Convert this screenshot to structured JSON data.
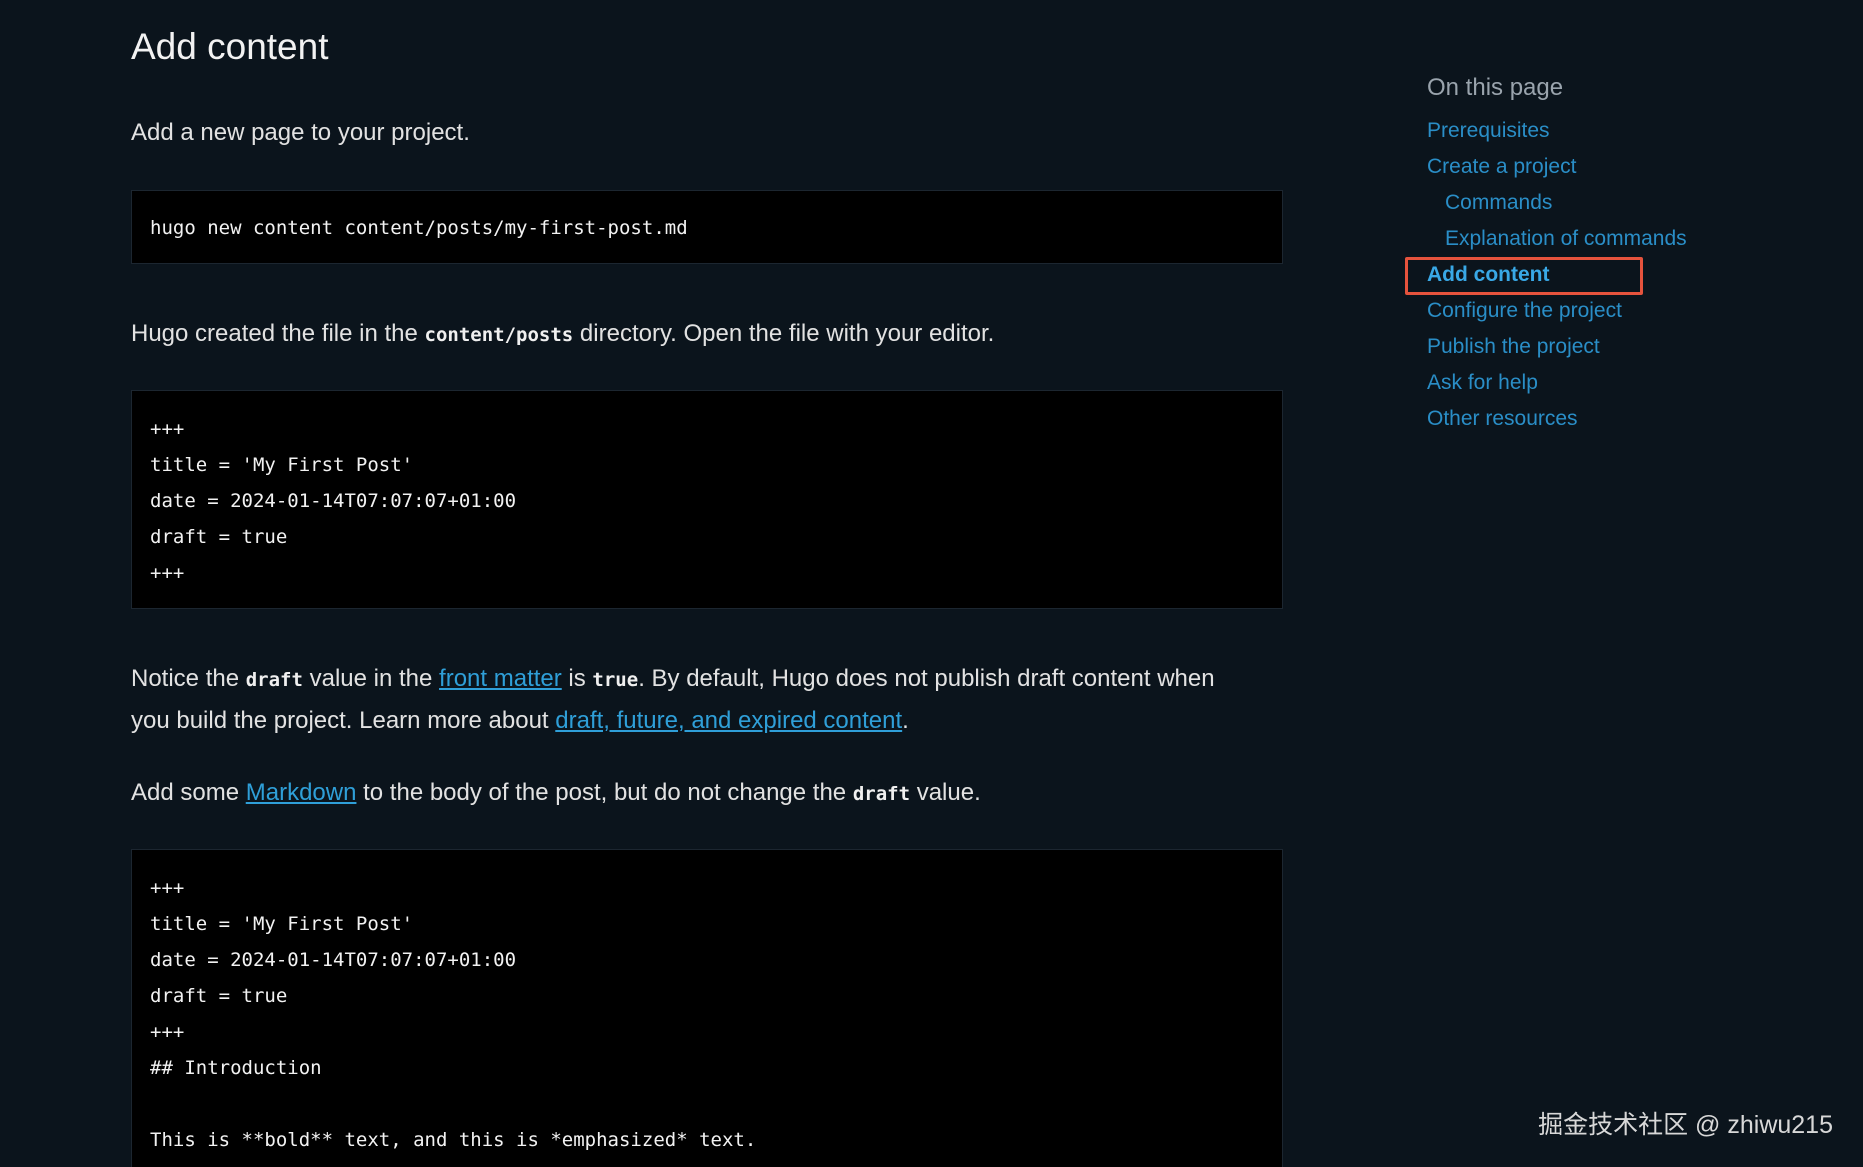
{
  "main": {
    "title": "Add content",
    "intro": "Add a new page to your project.",
    "command": "hugo new content content/posts/my-first-post.md",
    "created_text_1": "Hugo created the file in the ",
    "created_code": "content/posts",
    "created_text_2": " directory. Open the file with your editor.",
    "front_matter_lines": [
      "+++",
      "title = 'My First Post'",
      "date = 2024-01-14T07:07:07+01:00",
      "draft = true",
      "+++"
    ],
    "notice": {
      "t1": "Notice the ",
      "code1": "draft",
      "t2": " value in the ",
      "link1": "front matter",
      "t3": " is ",
      "code2": "true",
      "t4": ". By default, Hugo does not publish draft content when",
      "t5": "you build the project. Learn more about ",
      "link2": "draft, future, and expired content",
      "t6": "."
    },
    "markdown_para": {
      "t1": "Add some ",
      "link": "Markdown",
      "t2": " to the body of the post, but do not change the ",
      "code": "draft",
      "t3": " value."
    },
    "body_lines": [
      "+++",
      "title = 'My First Post'",
      "date = 2024-01-14T07:07:07+01:00",
      "draft = true",
      "+++",
      "## Introduction",
      "",
      "This is **bold** text, and this is *emphasized* text."
    ]
  },
  "toc": {
    "title": "On this page",
    "items": [
      {
        "label": "Prerequisites"
      },
      {
        "label": "Create a project"
      },
      {
        "label": "Commands"
      },
      {
        "label": "Explanation of commands"
      },
      {
        "label": "Add content"
      },
      {
        "label": "Configure the project"
      },
      {
        "label": "Publish the project"
      },
      {
        "label": "Ask for help"
      },
      {
        "label": "Other resources"
      }
    ]
  },
  "watermark": "掘金技术社区 @ zhiwu215",
  "colors": {
    "background": "#0b141c",
    "link": "#2f9fd8",
    "toc_link": "#2a8ec7",
    "highlight": "#e5533d"
  }
}
